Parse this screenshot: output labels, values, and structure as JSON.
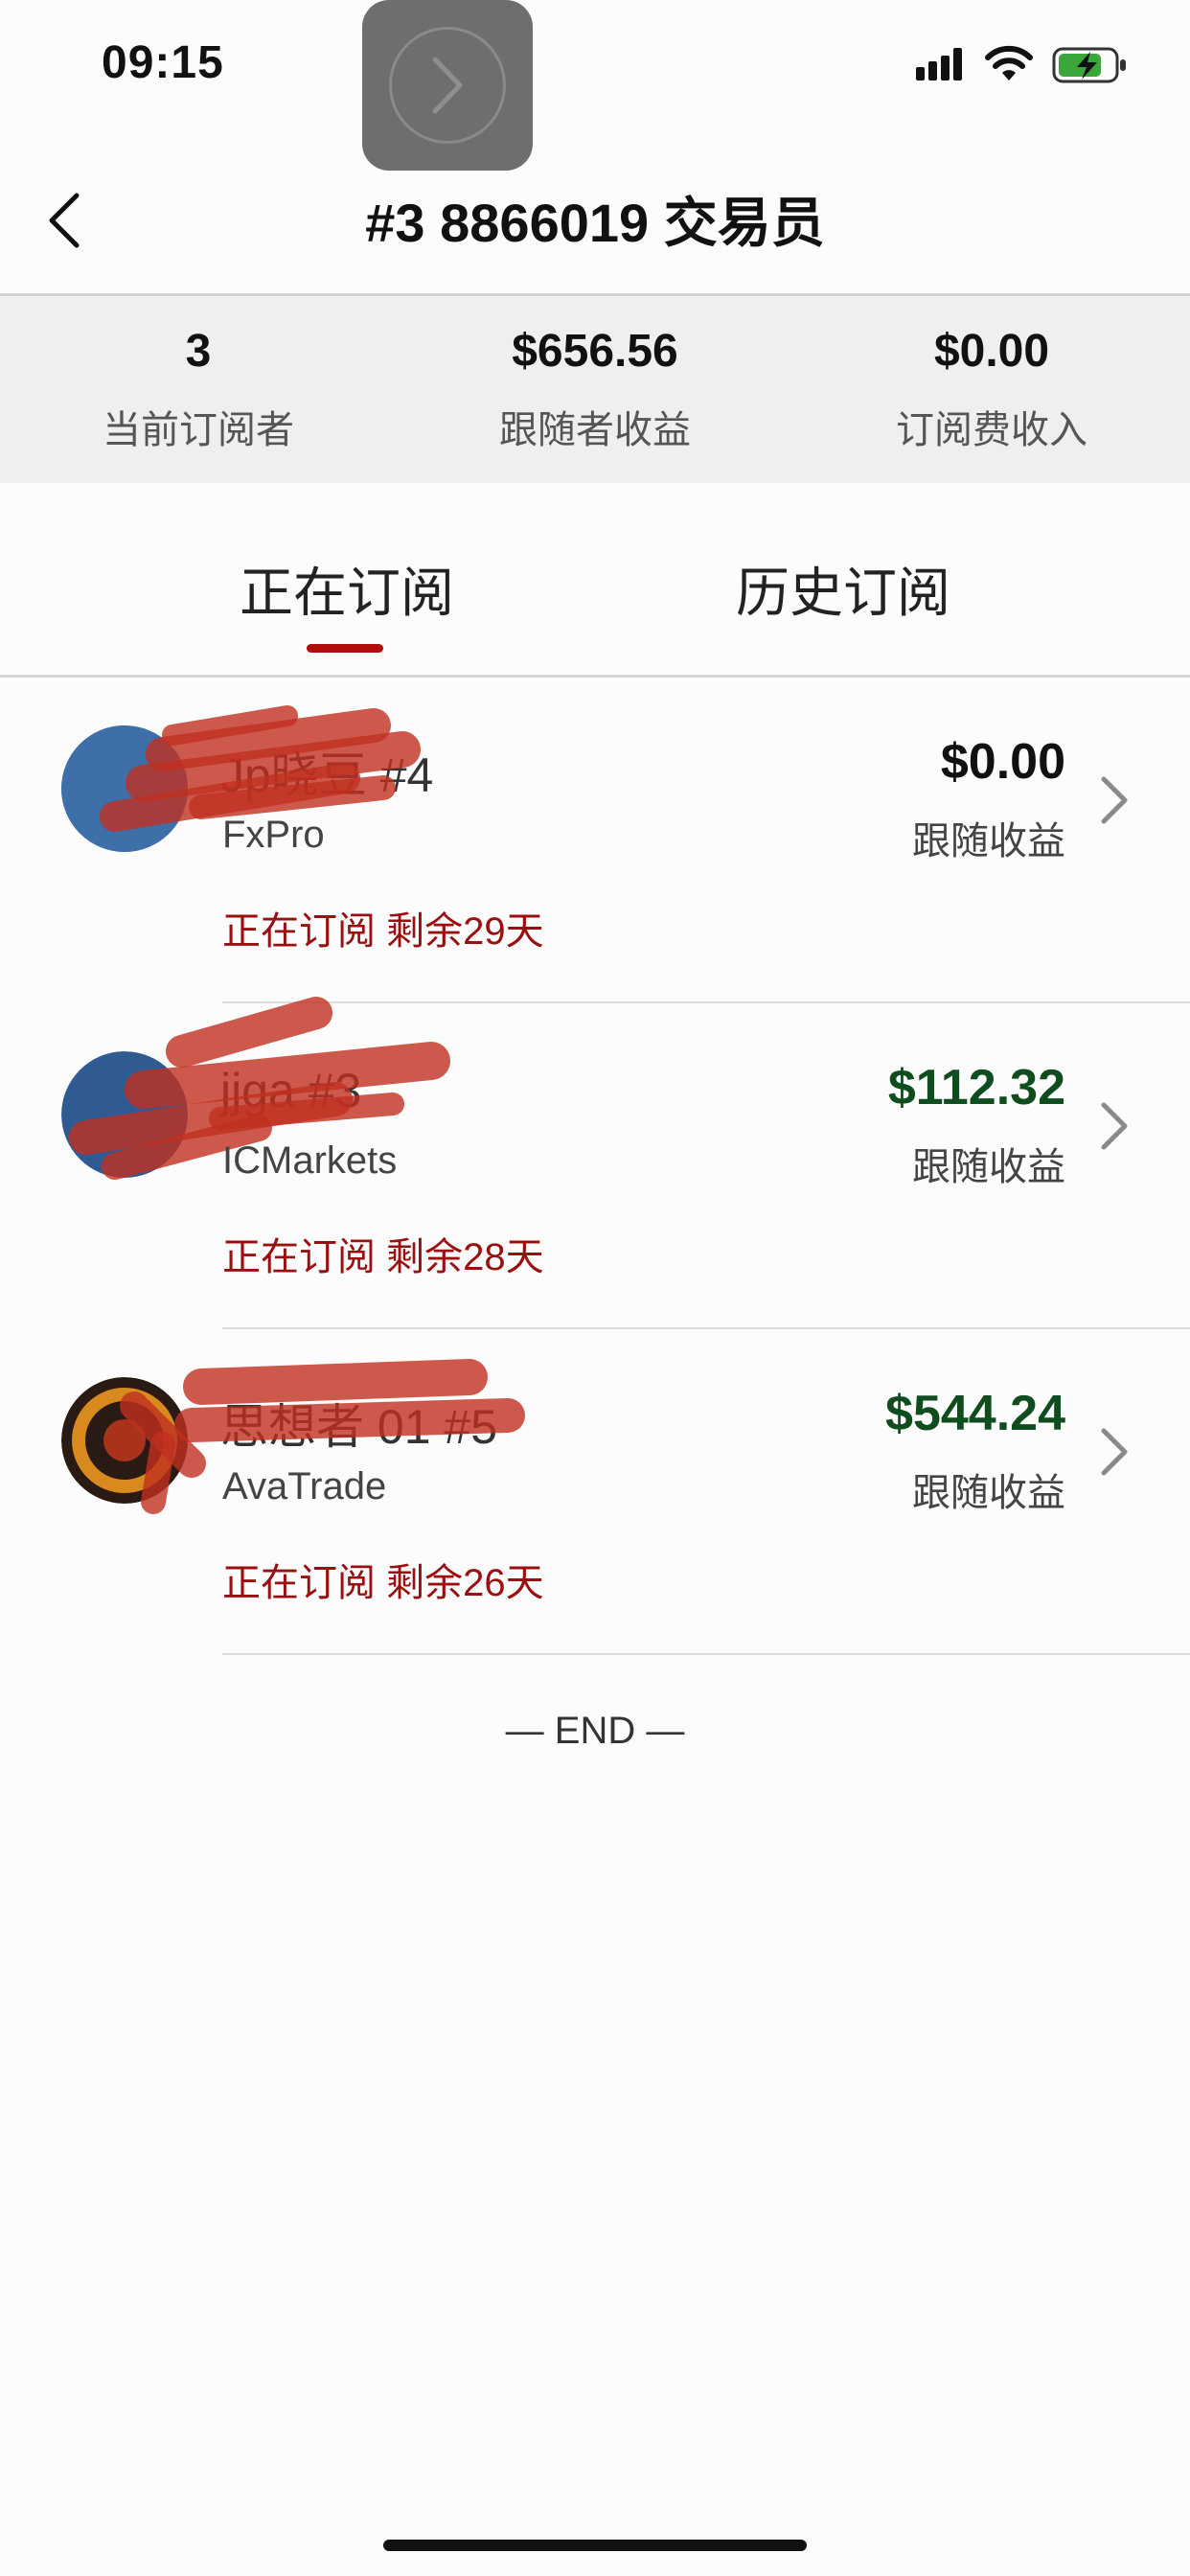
{
  "status_bar": {
    "time": "09:15"
  },
  "nav": {
    "title": "#3 8866019 交易员"
  },
  "stats": [
    {
      "value": "3",
      "label": "当前订阅者"
    },
    {
      "value": "$656.56",
      "label": "跟随者收益"
    },
    {
      "value": "$0.00",
      "label": "订阅费收入"
    }
  ],
  "tabs": [
    {
      "label": "正在订阅",
      "active": true
    },
    {
      "label": "历史订阅",
      "active": false
    }
  ],
  "subscriptions": [
    {
      "name": "Jp晓豆 #4",
      "broker": "FxPro",
      "status": "正在订阅 剩余29天",
      "amount": "$0.00",
      "amount_label": "跟随收益",
      "amount_color": "#111111"
    },
    {
      "name": "jjga #3",
      "broker": "ICMarkets",
      "status": "正在订阅 剩余28天",
      "amount": "$112.32",
      "amount_label": "跟随收益",
      "amount_color": "#0f4d1e"
    },
    {
      "name": "思想者 01 #5",
      "broker": "AvaTrade",
      "status": "正在订阅 剩余26天",
      "amount": "$544.24",
      "amount_label": "跟随收益",
      "amount_color": "#0f4d1e"
    }
  ],
  "footer": {
    "end_text": "— END —"
  },
  "colors": {
    "accent": "#b00d0d",
    "positive": "#0f4d1e",
    "stats_bg": "#efefef"
  }
}
